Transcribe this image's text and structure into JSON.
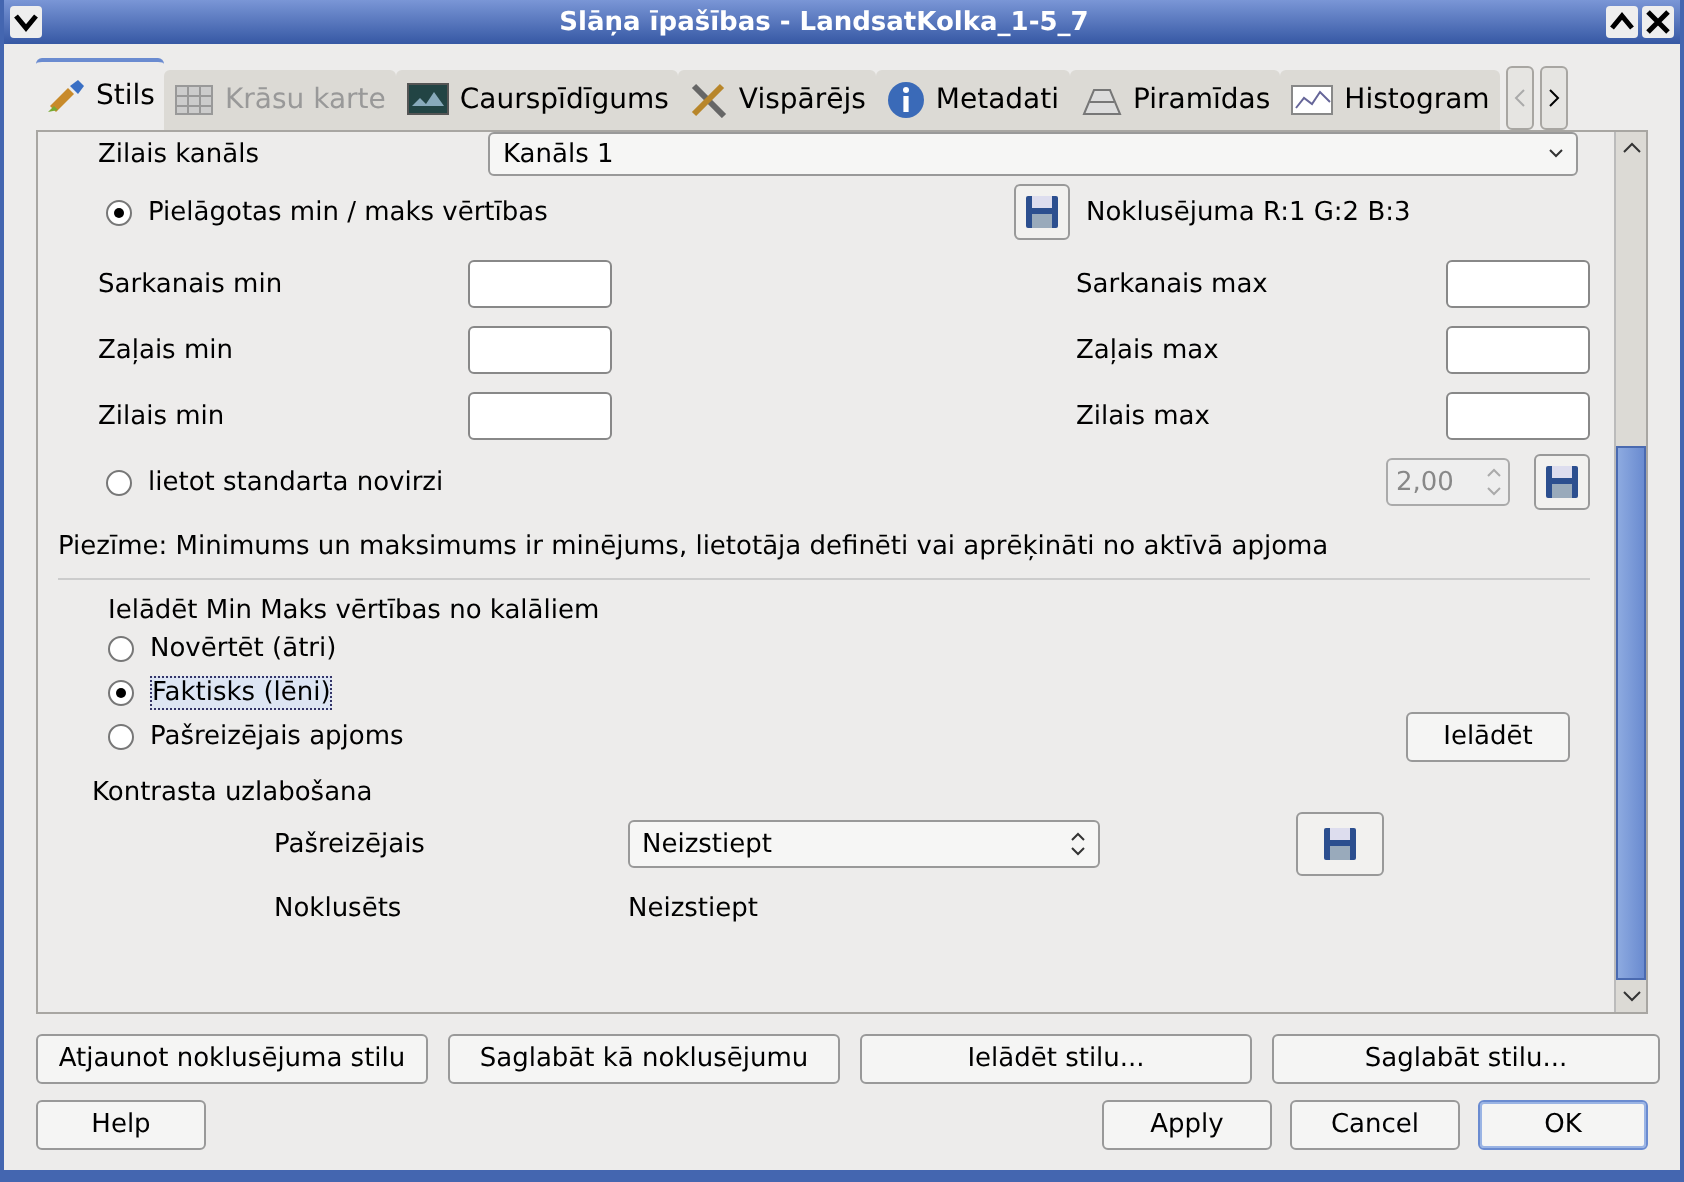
{
  "window": {
    "title": "Slāņa īpašības - LandsatKolka_1-5_7"
  },
  "tabs": [
    {
      "label": "Stils",
      "selected": true,
      "disabled": false
    },
    {
      "label": "Krāsu karte",
      "selected": false,
      "disabled": true
    },
    {
      "label": "Caurspīdīgums",
      "selected": false,
      "disabled": false
    },
    {
      "label": "Vispārējs",
      "selected": false,
      "disabled": false
    },
    {
      "label": "Metadati",
      "selected": false,
      "disabled": false
    },
    {
      "label": "Piramīdas",
      "selected": false,
      "disabled": false
    },
    {
      "label": "Histogram",
      "selected": false,
      "disabled": false
    }
  ],
  "band_row": {
    "label": "Zilais kanāls",
    "value": "Kanāls 1"
  },
  "minmax": {
    "label": "Pielāgotas min / maks vērtības",
    "selected": true,
    "default_button": "Noklusējuma R:1 G:2 B:3",
    "fields": [
      {
        "label": "Sarkanais min"
      },
      {
        "label": "Sarkanais max"
      },
      {
        "label": "Zaļais min"
      },
      {
        "label": "Zaļais max"
      },
      {
        "label": "Zilais min"
      },
      {
        "label": "Zilais max"
      }
    ]
  },
  "stddev": {
    "label": "lietot standarta novirzi",
    "selected": false,
    "value": "2,00",
    "disabled": true
  },
  "note": "Piezīme: Minimums un maksimums ir minējums, lietotāja definēti vai aprēķināti no aktīvā apjoma",
  "load": {
    "title": "Ielādēt Min Maks vērtības no kalāliem",
    "options": [
      {
        "label": "Novērtēt (ātri)",
        "selected": false
      },
      {
        "label": "Faktisks (lēni)",
        "selected": true
      },
      {
        "label": "Pašreizējais apjoms",
        "selected": false
      }
    ],
    "button": "Ielādēt"
  },
  "contrast": {
    "title": "Kontrasta uzlabošana",
    "current_label": "Pašreizējais",
    "current_value": "Neizstiept",
    "default_label": "Noklusēts",
    "default_value": "Neizstiept"
  },
  "style_buttons": [
    "Atjaunot noklusējuma stilu",
    "Saglabāt kā noklusējumu",
    "Ielādēt stilu...",
    "Saglabāt stilu..."
  ],
  "help_button": "Help",
  "actions": [
    {
      "label": "Apply",
      "default": false
    },
    {
      "label": "Cancel",
      "default": false
    },
    {
      "label": "OK",
      "default": true
    }
  ]
}
